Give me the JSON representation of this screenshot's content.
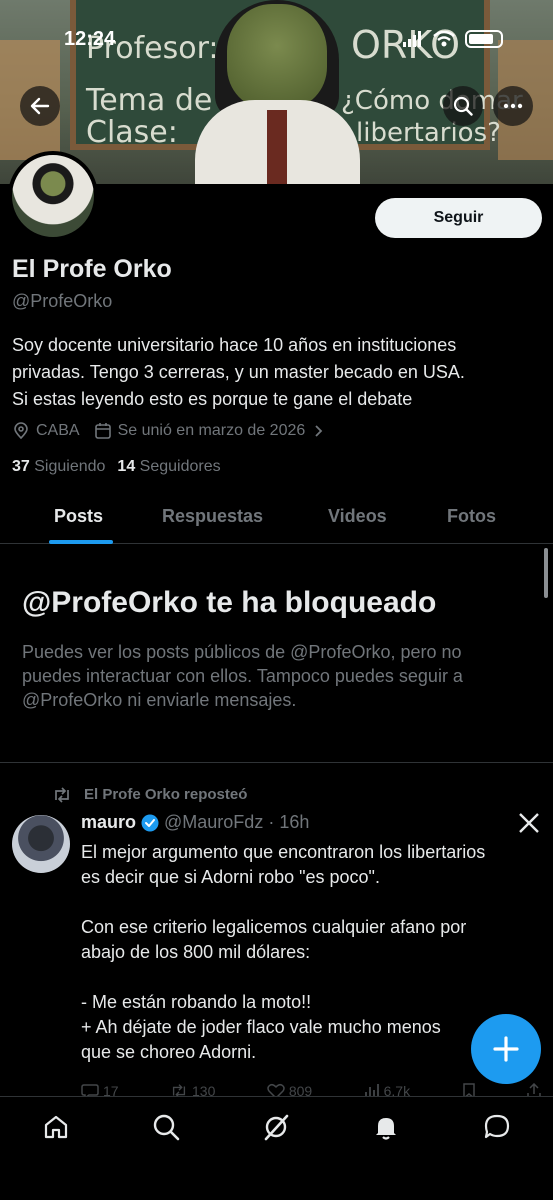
{
  "status_bar": {
    "time": "12:24"
  },
  "banner": {
    "board_line1": "Profesor:",
    "board_name": "ORKO",
    "board_line2": "Tema de la",
    "board_line3": "Clase:",
    "board_question1": "¿Cómo domar",
    "board_question2": "libertarios?"
  },
  "profile": {
    "name": "El Profe Orko",
    "handle": "@ProfeOrko",
    "follow_label": "Seguir",
    "bio": [
      "Soy docente universitario hace 10 años en instituciones",
      "privadas. Tengo 3 cerreras, y un master becado en USA.",
      "Si estas leyendo esto es porque te gane el debate"
    ],
    "location": "CABA",
    "joined": "Se unió en marzo de 2026",
    "following_count": "37",
    "following_label": "Siguiendo",
    "followers_count": "14",
    "followers_label": "Seguidores"
  },
  "tabs": [
    {
      "label": "Posts",
      "active": true
    },
    {
      "label": "Respuestas",
      "active": false
    },
    {
      "label": "Videos",
      "active": false
    },
    {
      "label": "Fotos",
      "active": false
    }
  ],
  "blocked": {
    "title": "@ProfeOrko te ha bloqueado",
    "description": [
      "Puedes ver los posts públicos de @ProfeOrko, pero no",
      "puedes interactuar con ellos. Tampoco puedes seguir a",
      "@ProfeOrko ni enviarle mensajes."
    ]
  },
  "tweet": {
    "repost_label": "El Profe Orko reposteó",
    "author_name": "mauro",
    "author_handle": "@MauroFdz",
    "time": "· 16h",
    "body": [
      "El mejor argumento que encontraron los libertarios",
      "es decir que si Adorni robo \"es poco\".",
      "",
      "Con ese criterio legalicemos cualquier afano por",
      "abajo de los 800 mil dólares:",
      "",
      "- Me están robando la moto!!",
      "+ Ah déjate de joder flaco vale mucho menos",
      "que se choreo Adorni."
    ],
    "replies": "17",
    "reposts": "130",
    "likes": "809",
    "views": "6,7k"
  },
  "colors": {
    "accent": "#1d9bf0",
    "muted": "#71767b",
    "text": "#e7e9ea",
    "background": "#000000"
  }
}
